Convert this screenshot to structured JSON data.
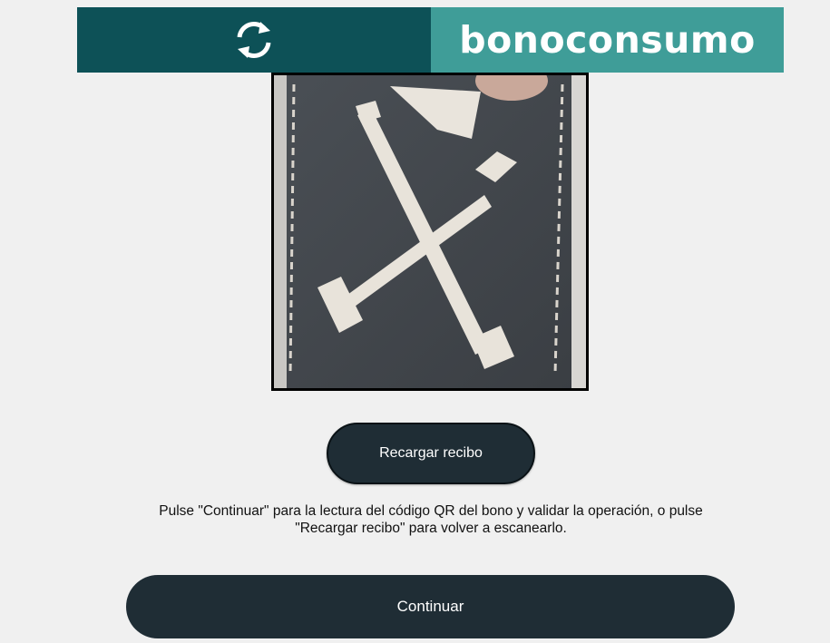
{
  "header": {
    "reload_icon": "refresh-icon",
    "brand": "bonoconsumo",
    "colors": {
      "left": "#0d5157",
      "right": "#3f9d98"
    }
  },
  "buttons": {
    "reload_label": "Recargar recibo",
    "continue_label": "Continuar"
  },
  "instructions": {
    "line1": "Pulse \"Continuar\" para la lectura del código QR del bono y validar la operación, o pulse",
    "line2": "\"Recargar recibo\" para volver a escanearlo."
  }
}
